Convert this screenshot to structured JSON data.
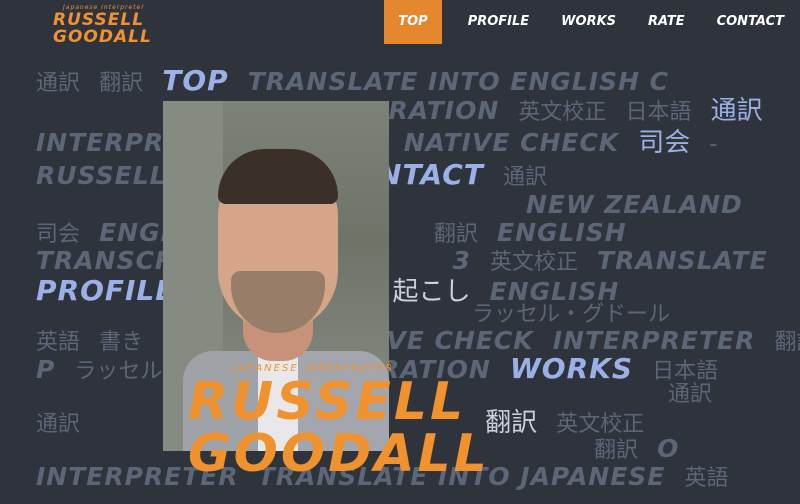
{
  "header": {
    "logo_subtitle": "Japanese Interpreter",
    "logo_line1": "RUSSELL",
    "logo_line2": "GOODALL"
  },
  "nav": {
    "items": [
      {
        "label": "TOP",
        "active": true
      },
      {
        "label": "PROFILE",
        "active": false
      },
      {
        "label": "WORKS",
        "active": false
      },
      {
        "label": "RATE",
        "active": false
      },
      {
        "label": "CONTACT",
        "active": false
      }
    ]
  },
  "word_wall": {
    "row1": [
      "通訳",
      "翻訳",
      "TOP",
      "TRANSLATE INTO ENGLISH C"
    ],
    "row2": [
      "NARRATION",
      "英文校正",
      "日本語",
      "通訳"
    ],
    "row3": [
      "INTERPRETER",
      "NATIVE CHECK",
      "司会",
      "-"
    ],
    "row4": [
      "RUSSELL",
      "CONTACT",
      "通訳"
    ],
    "row5": [
      "NEW ZEALAND"
    ],
    "row6": [
      "司会",
      "ENGLISH",
      "翻訳",
      "ENGLISH"
    ],
    "row7": [
      "TRANSCRIPTION",
      "3",
      "英文校正",
      "TRANSLATE"
    ],
    "row8": [
      "PROFILE",
      "書き起こし",
      "ENGLISH"
    ],
    "row9": [
      "ラッセル・グドール"
    ],
    "row10": [
      "英語",
      "書き",
      "NATIVE CHECK",
      "INTERPRETER",
      "翻訳"
    ],
    "row11": [
      "P",
      "ラッセル",
      "NARRATION",
      "WORKS",
      "日本語"
    ],
    "row12": [
      "通訳"
    ],
    "row13": [
      "通訳",
      "翻訳",
      "翻訳",
      "英文校正"
    ],
    "row14": [
      "翻訳",
      "O"
    ],
    "row15": [
      "INTERPRETER",
      "TRANSLATE INTO JAPANESE",
      "英語"
    ]
  },
  "brand": {
    "subtitle": "JAPANESE INTERPRETER",
    "line1": "RUSSELL",
    "line2": "GOODALL"
  },
  "colors": {
    "background": "#2f333c",
    "accent": "#f0922e",
    "highlight": "#9ab0e6",
    "muted_word": "#5c6677"
  }
}
